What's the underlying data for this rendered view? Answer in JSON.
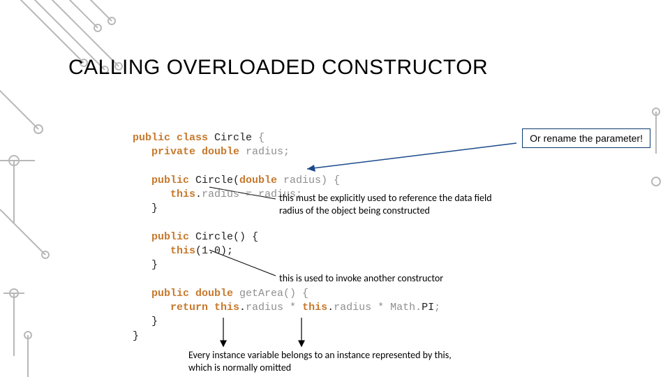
{
  "heading": "CALLING OVERLOADED CONSTRUCTOR",
  "callout": "Or rename the parameter!",
  "code": {
    "l1a": "public class ",
    "l1b": "Circle",
    "l1c": " {",
    "l2a": "   private double ",
    "l2b": "radius;",
    "l3": " ",
    "l4a": "   public ",
    "l4b": "Circle(",
    "l4c": "double ",
    "l4d": "radius) {",
    "l5a": "      this",
    "l5b": ".",
    "l5c": "radius = radius;",
    "l6": "   }",
    "l7": " ",
    "l8a": "   public ",
    "l8b": "Circle() {",
    "l9a": "      this",
    "l9b": "(1.0);",
    "l10": "   }",
    "l11": " ",
    "l12a": "   public double ",
    "l12b": "getArea() {",
    "l13a": "      return this",
    "l13b": ".",
    "l13c": "radius * ",
    "l13d": "this",
    "l13e": ".",
    "l13f": "radius * Math.",
    "l13g": "PI",
    "l13h": ";",
    "l14": "   }",
    "l15": "}"
  },
  "annotations": {
    "a1": "this must be explicitly used to reference the data field radius of the object being constructed",
    "a2": "this is used to invoke another constructor",
    "a3": "Every instance variable belongs to an instance represented by this, which is normally omitted"
  }
}
